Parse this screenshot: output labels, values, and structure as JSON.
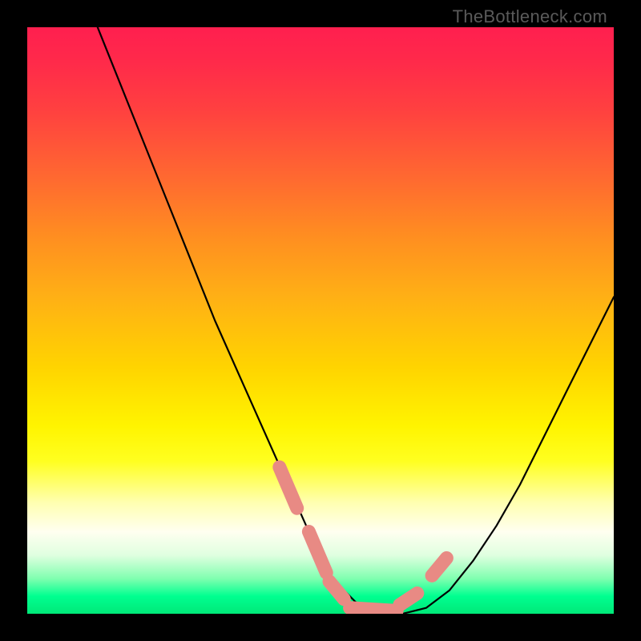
{
  "attribution": "TheBottleneck.com",
  "chart_data": {
    "type": "line",
    "title": "",
    "xlabel": "",
    "ylabel": "",
    "xlim": [
      0,
      100
    ],
    "ylim": [
      0,
      100
    ],
    "grid": false,
    "legend_position": "none",
    "series": [
      {
        "name": "bottleneck-curve",
        "color": "#000000",
        "x": [
          12,
          16,
          20,
          24,
          28,
          32,
          36,
          40,
          44,
          48,
          52,
          56,
          60,
          64,
          68,
          72,
          76,
          80,
          84,
          88,
          92,
          96,
          100
        ],
        "y": [
          100,
          90,
          80,
          70,
          60,
          50,
          41,
          32,
          23,
          14,
          6,
          2,
          0,
          0,
          1,
          4,
          9,
          15,
          22,
          30,
          38,
          46,
          54
        ]
      },
      {
        "name": "highlight-segments",
        "color": "#e88a84",
        "segments": [
          {
            "x": [
              43,
              46
            ],
            "y": [
              25,
              18
            ]
          },
          {
            "x": [
              48,
              51
            ],
            "y": [
              14,
              7
            ]
          },
          {
            "x": [
              51.5,
              54
            ],
            "y": [
              5.5,
              2.5
            ]
          },
          {
            "x": [
              55,
              63
            ],
            "y": [
              1,
              0.5
            ]
          },
          {
            "x": [
              63.5,
              66.5
            ],
            "y": [
              1.5,
              3.5
            ]
          },
          {
            "x": [
              69,
              71.5
            ],
            "y": [
              6.5,
              9.5
            ]
          }
        ]
      }
    ]
  }
}
